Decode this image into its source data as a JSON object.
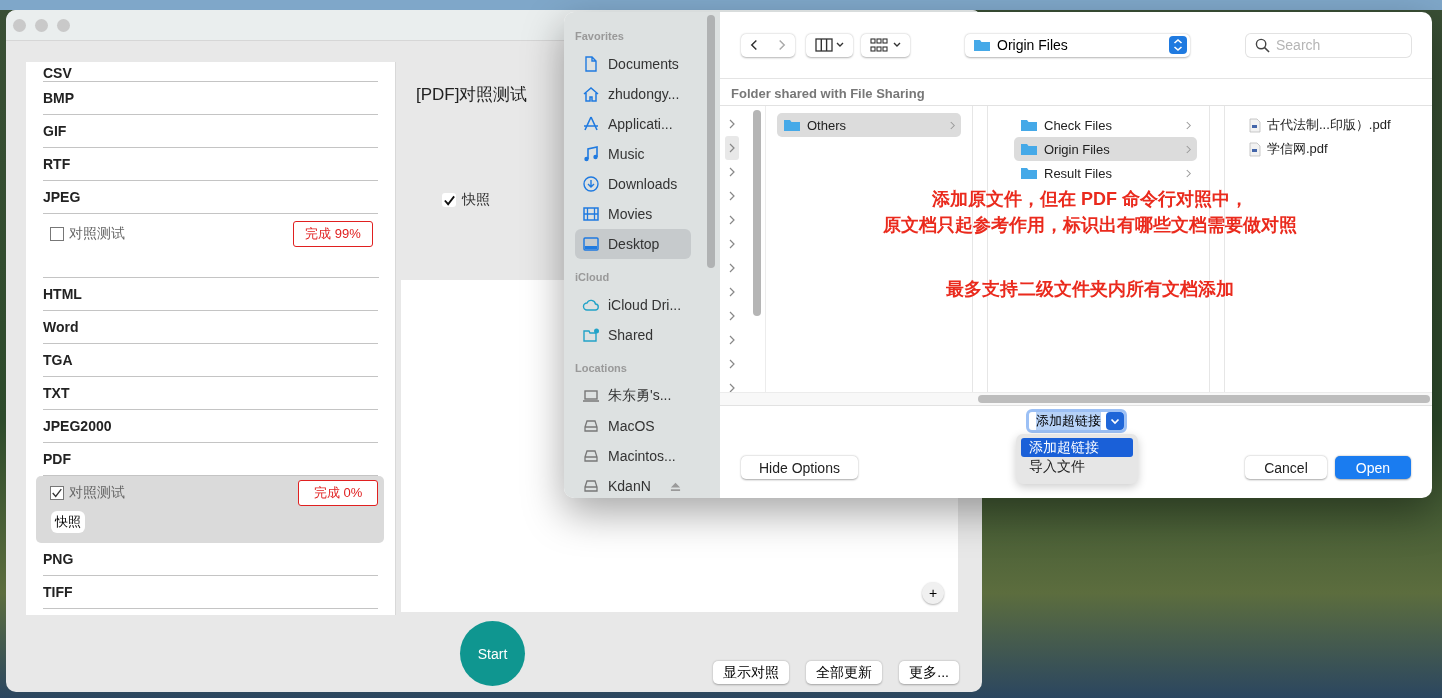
{
  "format_list": [
    {
      "kind": "format",
      "label": "CSV"
    },
    {
      "kind": "format",
      "label": "BMP"
    },
    {
      "kind": "format",
      "label": "GIF"
    },
    {
      "kind": "format",
      "label": "RTF"
    },
    {
      "kind": "format",
      "label": "JPEG"
    },
    {
      "kind": "task",
      "label": "对照测试",
      "checked": false,
      "status": "完成 99%",
      "selected": false
    },
    {
      "kind": "format",
      "label": "HTML"
    },
    {
      "kind": "format",
      "label": "Word"
    },
    {
      "kind": "format",
      "label": "TGA"
    },
    {
      "kind": "format",
      "label": "TXT"
    },
    {
      "kind": "format",
      "label": "JPEG2000"
    },
    {
      "kind": "format",
      "label": "PDF"
    },
    {
      "kind": "task",
      "label": "对照测试",
      "checked": true,
      "status": "完成 0%",
      "selected": true,
      "tags": [
        "快照"
      ]
    },
    {
      "kind": "format",
      "label": "PNG"
    },
    {
      "kind": "format",
      "label": "TIFF"
    }
  ],
  "detail": {
    "title": "[PDF]对照测试",
    "options": [
      {
        "label": "快照",
        "checked": true
      }
    ],
    "add_button": "+"
  },
  "start_button": "Start",
  "footer_buttons": [
    "显示对照",
    "全部更新",
    "更多..."
  ],
  "dialog": {
    "sidebar": [
      {
        "header": "Favorites",
        "items": [
          {
            "kind": "document",
            "label": "Documents",
            "selected": false
          },
          {
            "kind": "home",
            "label": "zhudongy...",
            "selected": false
          },
          {
            "kind": "apps",
            "label": "Applicati...",
            "selected": false
          },
          {
            "kind": "music",
            "label": "Music",
            "selected": false
          },
          {
            "kind": "download",
            "label": "Downloads",
            "selected": false
          },
          {
            "kind": "film",
            "label": "Movies",
            "selected": false
          },
          {
            "kind": "desktop",
            "label": "Desktop",
            "selected": true
          }
        ]
      },
      {
        "header": "iCloud",
        "items": [
          {
            "kind": "cloud",
            "label": "iCloud Dri...",
            "selected": false
          },
          {
            "kind": "shared",
            "label": "Shared",
            "selected": false
          }
        ]
      },
      {
        "header": "Locations",
        "items": [
          {
            "kind": "computer",
            "label": "朱东勇's...",
            "selected": false
          },
          {
            "kind": "disk",
            "label": "MacOS",
            "selected": false
          },
          {
            "kind": "disk",
            "label": "Macintos...",
            "selected": false
          },
          {
            "kind": "ejectable-disk",
            "label": "KdanN",
            "selected": false
          }
        ]
      }
    ],
    "path_popup": "Origin Files",
    "search": {
      "placeholder": "Search"
    },
    "header": "Folder shared with File Sharing",
    "columns": [
      [
        {
          "kind": "folder",
          "name": "Others",
          "selected": true
        }
      ],
      [
        {
          "kind": "folder",
          "name": "Check Files",
          "selected": false
        },
        {
          "kind": "folder",
          "name": "Origin Files",
          "selected": true
        },
        {
          "kind": "folder",
          "name": "Result Files",
          "selected": false
        }
      ],
      [
        {
          "kind": "file",
          "name": "古代法制...印版）.pdf",
          "selected": false
        },
        {
          "kind": "file",
          "name": "学信网.pdf",
          "selected": false
        }
      ]
    ],
    "format_popup": "添加超链接",
    "format_menu": [
      {
        "label": "添加超链接",
        "selected": true
      },
      {
        "label": "导入文件",
        "selected": false
      }
    ],
    "buttons": [
      {
        "kind": "secondary",
        "label": "Hide Options"
      },
      {
        "kind": "secondary",
        "label": "Cancel"
      },
      {
        "kind": "primary",
        "label": "Open"
      }
    ]
  },
  "annotation": {
    "lines": [
      "添加原文件，但在 PDF 命令行对照中，",
      "原文档只起参考作用，标识出有哪些文档需要做对照"
    ],
    "note": "最多支持二级文件夹内所有文档添加"
  }
}
